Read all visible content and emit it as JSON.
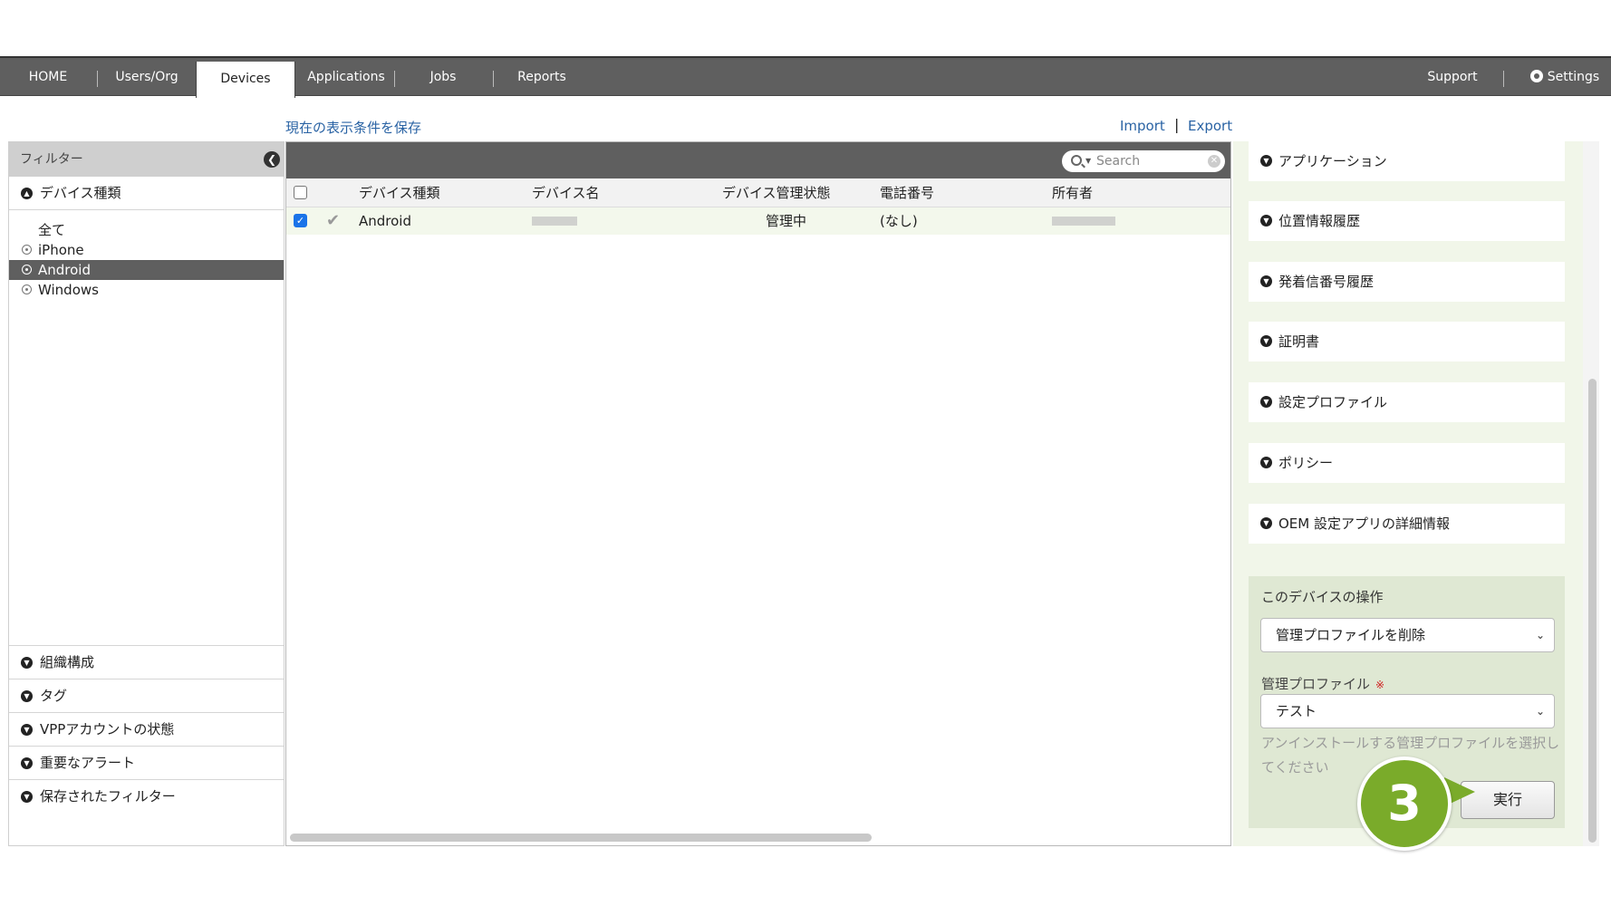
{
  "nav": {
    "items": [
      "HOME",
      "Users/Org",
      "Devices",
      "Applications",
      "Jobs",
      "Reports"
    ],
    "active": "Devices",
    "right_items": [
      "Support",
      "Settings"
    ]
  },
  "toolbar_links": {
    "save_view": "現在の表示条件を保存",
    "import": "Import",
    "separator": "|",
    "export": "Export"
  },
  "filter": {
    "title": "フィルター",
    "device_type_section": "デバイス種類",
    "device_types": [
      "全て",
      "iPhone",
      "Android",
      "Windows"
    ],
    "selected_type": "Android",
    "bottom_sections": [
      "組織構成",
      "タグ",
      "VPPアカウントの状態",
      "重要なアラート",
      "保存されたフィルター"
    ]
  },
  "table": {
    "search_placeholder": "Search",
    "columns": [
      "デバイス種類",
      "デバイス名",
      "デバイス管理状態",
      "電話番号",
      "所有者"
    ],
    "rows": [
      {
        "type": "Android",
        "name": "",
        "status": "管理中",
        "phone": "(なし)",
        "owner": "",
        "checked": true
      }
    ]
  },
  "right_panel": {
    "accordions": [
      "アプリケーション",
      "位置情報履歴",
      "発着信番号履歴",
      "証明書",
      "設定プロファイル",
      "ポリシー",
      "OEM 設定アプリの詳細情報"
    ],
    "ops": {
      "title": "このデバイスの操作",
      "action_select": "管理プロファイルを削除",
      "profile_label": "管理プロファイル",
      "required_mark": "※",
      "profile_select": "テスト",
      "help_text": "アンインストールする管理プロファイルを選択してください",
      "execute_label": "実行"
    }
  },
  "annotation": {
    "step": "3"
  },
  "colors": {
    "nav_bg": "#5f5f5f",
    "link": "#2a63a4",
    "panel_green": "#f1f6e9",
    "badge_green": "#7aab2a"
  }
}
